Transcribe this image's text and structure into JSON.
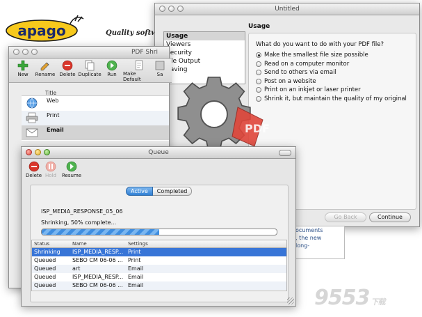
{
  "logo": {
    "brand": "apago",
    "tagline": "Quality software"
  },
  "usage_window": {
    "title": "Untitled",
    "categories": [
      {
        "label": "Usage",
        "selected": true
      },
      {
        "label": "Viewers",
        "selected": false
      },
      {
        "label": "Security",
        "selected": false
      },
      {
        "label": "File Output",
        "selected": false
      },
      {
        "label": "Saving",
        "selected": false
      }
    ],
    "section_title": "Usage",
    "question": "What do you want to do with your PDF file?",
    "options": [
      {
        "label": "Make the smallest file size possible",
        "selected": true
      },
      {
        "label": "Read on a computer monitor",
        "selected": false
      },
      {
        "label": "Send to others via email",
        "selected": false
      },
      {
        "label": "Post on a website",
        "selected": false
      },
      {
        "label": "Print on an inkjet or laser printer",
        "selected": false
      },
      {
        "label": "Shrink it, but maintain the quality of my original",
        "selected": false
      }
    ],
    "go_back_label": "Go Back",
    "continue_label": "Continue"
  },
  "shrink_window": {
    "title": "PDF Shri",
    "toolbar": [
      {
        "label": "New",
        "icon": "new-icon"
      },
      {
        "label": "Rename",
        "icon": "rename-icon"
      },
      {
        "label": "Delete",
        "icon": "delete-icon"
      },
      {
        "label": "Duplicate",
        "icon": "duplicate-icon"
      },
      {
        "label": "Run",
        "icon": "run-icon"
      },
      {
        "label": "Make Default",
        "icon": "make-default-icon"
      },
      {
        "label": "Sa",
        "icon": "save-icon"
      }
    ],
    "column_title": "Title",
    "presets": [
      {
        "label": "Web",
        "icon": "web-icon"
      },
      {
        "label": "Print",
        "icon": "printer-icon"
      },
      {
        "label": "Email",
        "icon": "email-icon"
      }
    ],
    "peek_text": [
      "ocuments",
      ", the new",
      "long-"
    ]
  },
  "queue_window": {
    "title": "Queue",
    "toolbar": [
      {
        "label": "Delete",
        "icon": "delete-icon",
        "enabled": true
      },
      {
        "label": "Hold",
        "icon": "hold-icon",
        "enabled": false
      },
      {
        "label": "Resume",
        "icon": "resume-icon",
        "enabled": true
      }
    ],
    "tabs": {
      "active": "Active",
      "completed": "Completed"
    },
    "job_name": "ISP_MEDIA_RESPONSE_05_06",
    "job_status": "Shrinking, 50% complete...",
    "progress": 0.5,
    "columns": [
      "Status",
      "Name",
      "Settings"
    ],
    "rows": [
      {
        "status": "Shrinking",
        "name": "ISP_MEDIA_RESP...",
        "settings": "Print"
      },
      {
        "status": "Queued",
        "name": "SEBO CM 06-06 ...",
        "settings": "Print"
      },
      {
        "status": "Queued",
        "name": "art",
        "settings": "Email"
      },
      {
        "status": "Queued",
        "name": "ISP_MEDIA_RESP...",
        "settings": "Email"
      },
      {
        "status": "Queued",
        "name": "SEBO CM 06-06 ...",
        "settings": "Email"
      }
    ]
  },
  "watermark": {
    "text": "9553",
    "suffix": "下载"
  },
  "colors": {
    "selection": "#3875d7",
    "progress": "#3f8ee0",
    "brand_yellow": "#f7c91c"
  }
}
